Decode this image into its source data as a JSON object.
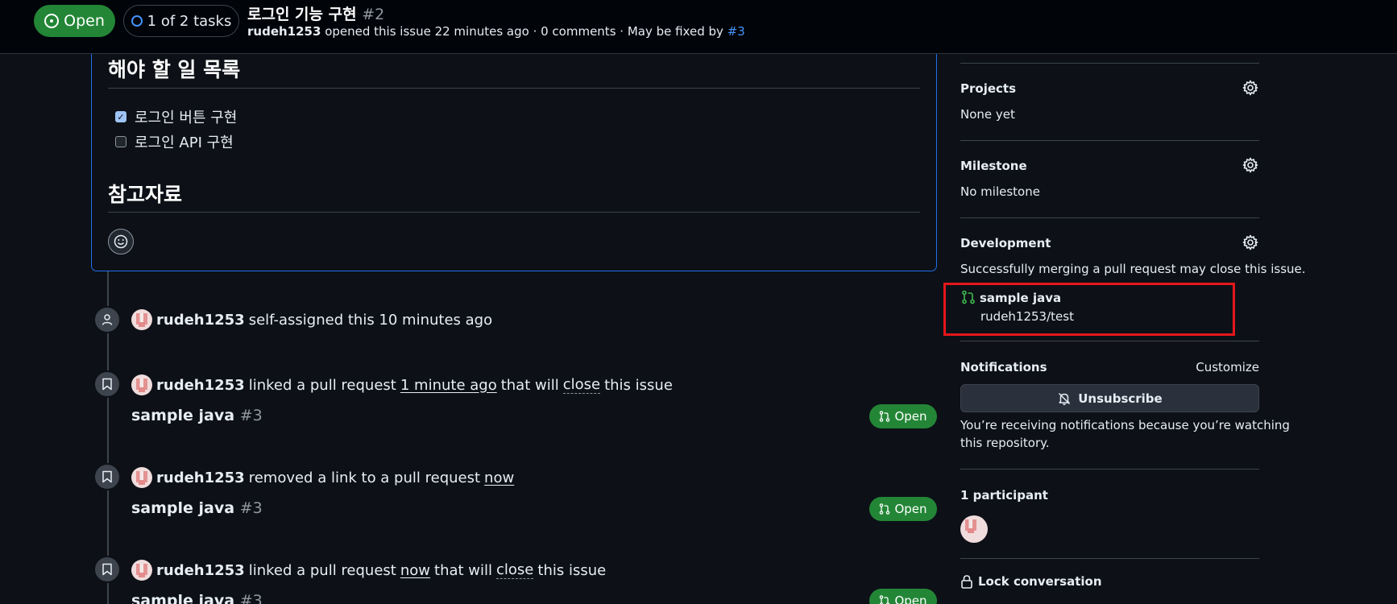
{
  "header": {
    "status": "Open",
    "tasks": "1 of 2 tasks",
    "title": "로그인 기능 구현",
    "number": "#2",
    "author": "rudeh1253",
    "meta": " opened this issue 22 minutes ago · 0 comments · May be fixed by ",
    "fixed_by": "#3"
  },
  "body": {
    "todo_heading": "해야 할 일 목록",
    "tasks": [
      {
        "label": "로그인 버튼 구현",
        "checked": true
      },
      {
        "label": "로그인 API 구현",
        "checked": false
      }
    ],
    "ref_heading": "참고자료"
  },
  "timeline": {
    "e1": {
      "user": "rudeh1253",
      "text": "self-assigned this 10 minutes ago"
    },
    "e2": {
      "user": "rudeh1253",
      "pre": "linked a pull request",
      "time": "1 minute ago",
      "mid": "that will",
      "verb": "close",
      "post": "this issue",
      "pr_title": "sample java",
      "pr_num": "#3",
      "pr_status": "Open"
    },
    "e3": {
      "user": "rudeh1253",
      "pre": "removed a link to a pull request",
      "time": "now",
      "pr_title": "sample java",
      "pr_num": "#3",
      "pr_status": "Open"
    },
    "e4": {
      "user": "rudeh1253",
      "pre": "linked a pull request",
      "time": "now",
      "mid": "that will",
      "verb": "close",
      "post": "this issue",
      "pr_title": "sample java",
      "pr_num": "#3",
      "pr_status": "Open"
    }
  },
  "sidebar": {
    "projects": {
      "label": "Projects",
      "value": "None yet"
    },
    "milestone": {
      "label": "Milestone",
      "value": "No milestone"
    },
    "development": {
      "label": "Development",
      "desc": "Successfully merging a pull request may close this issue.",
      "pr_name": "sample java",
      "pr_repo": "rudeh1253/test"
    },
    "notifications": {
      "label": "Notifications",
      "customize": "Customize",
      "button": "Unsubscribe",
      "desc_line1": "You’re receiving notifications because you’re watching",
      "desc_line2": "this repository."
    },
    "participants": {
      "label": "1 participant"
    },
    "lock": {
      "label": "Lock conversation"
    }
  },
  "colors": {
    "accent_green": "#238636",
    "link_blue": "#4493f8",
    "highlight_red": "#e5171c"
  }
}
